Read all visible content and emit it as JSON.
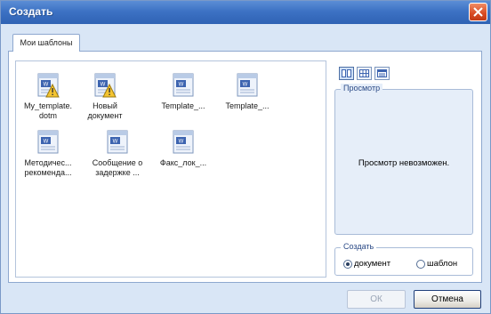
{
  "window": {
    "title": "Создать"
  },
  "tabs": [
    {
      "label": "Мои шаблоны"
    }
  ],
  "templates": [
    {
      "label": "My_template.\ndotm",
      "icon": "word-template-macro-icon"
    },
    {
      "label": "Новый\nдокумент",
      "icon": "word-template-macro-icon"
    },
    {
      "label": "Template_...",
      "icon": "word-template-icon"
    },
    {
      "label": "Template_...",
      "icon": "word-template-icon"
    },
    {
      "label": "Методичес...\nрекоменда...",
      "icon": "word-template-icon"
    },
    {
      "label": "Сообщение о\nзадержке ...",
      "icon": "word-template-icon"
    },
    {
      "label": "Факс_лок_...",
      "icon": "word-template-icon"
    }
  ],
  "view_buttons": [
    "large-icons-view-icon",
    "list-view-icon",
    "details-view-icon"
  ],
  "preview": {
    "legend": "Просмотр",
    "message": "Просмотр невозможен."
  },
  "create": {
    "legend": "Создать",
    "options": [
      {
        "label": "документ",
        "checked": true
      },
      {
        "label": "шаблон",
        "checked": false
      }
    ]
  },
  "buttons": {
    "ok": "ОК",
    "cancel": "Отмена"
  }
}
